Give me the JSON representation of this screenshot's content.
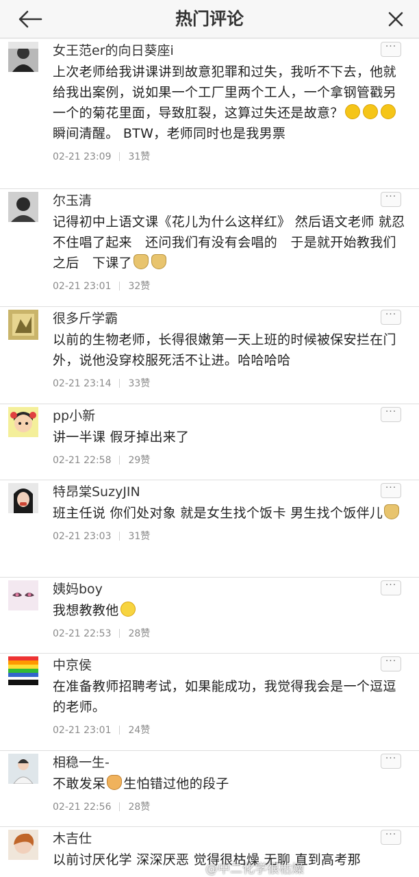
{
  "header": {
    "title": "热门评论",
    "back_icon": "arrow-left-icon",
    "close_icon": "close-icon"
  },
  "comments": [
    {
      "username": "女王范er的向日葵座i",
      "text_parts": [
        "上次老师给我讲课讲到故意犯罪和过失，我听不下去，他就给我出案例，说如果一个工厂里两个工人，一个拿钢管戳另一个的菊花里面，导致肛裂，这算过失还是故意？",
        "瞬间清醒。 BTW，老师同时也是我男票"
      ],
      "emojis": [
        "laugh",
        "laugh",
        "laugh"
      ],
      "time": "02-21 23:09",
      "likes": "31赞"
    },
    {
      "username": "尔玉清",
      "text_parts": [
        "记得初中上语文课《花儿为什么这样红》 然后语文老师 就忍不住唱了起来　还问我们有没有会唱的　于是就开始教我们　之后　下课了",
        ""
      ],
      "emojis": [
        "doge",
        "doge"
      ],
      "time": "02-21 23:01",
      "likes": "32赞"
    },
    {
      "username": "很多斤学霸",
      "text_parts": [
        "以前的生物老师，长得很嫩第一天上班的时候被保安拦在门外，说他没穿校服死活不让进。哈哈哈哈",
        ""
      ],
      "emojis": [],
      "time": "02-21 23:14",
      "likes": "33赞"
    },
    {
      "username": "pp小新",
      "text_parts": [
        "讲一半课 假牙掉出来了",
        ""
      ],
      "emojis": [],
      "time": "02-21 22:58",
      "likes": "29赞"
    },
    {
      "username": "特昂棠SuzyJIN",
      "text_parts": [
        "班主任说 你们处对象 就是女生找个饭卡 男生找个饭伴儿",
        ""
      ],
      "emojis": [
        "doge"
      ],
      "time": "02-21 23:03",
      "likes": "31赞"
    },
    {
      "username": "姨妈boy",
      "text_parts": [
        "我想教教他",
        ""
      ],
      "emojis": [
        "smile"
      ],
      "time": "02-21 22:53",
      "likes": "28赞"
    },
    {
      "username": "中京侯",
      "text_parts": [
        "在准备教师招聘考试，如果能成功，我觉得我会是一个逗逗的老师。",
        ""
      ],
      "emojis": [],
      "time": "02-21 23:01",
      "likes": "24赞"
    },
    {
      "username": "相稳一生-",
      "text_parts": [
        "不敢发呆",
        "生怕错过他的段子"
      ],
      "emojis": [
        "cat"
      ],
      "time": "02-21 22:56",
      "likes": "28赞"
    },
    {
      "username": "木吉仕",
      "text_parts": [
        "以前讨厌化学 深深厌恶 觉得很枯燥 无聊 直到高考那",
        ""
      ],
      "emojis": [],
      "time": "",
      "likes": ""
    }
  ],
  "more_label": "···",
  "watermark": "@中二化学很枯燥",
  "colors": {
    "background": "#f2f2f2",
    "card": "#ffffff",
    "meta_text": "#8a8a8a"
  }
}
